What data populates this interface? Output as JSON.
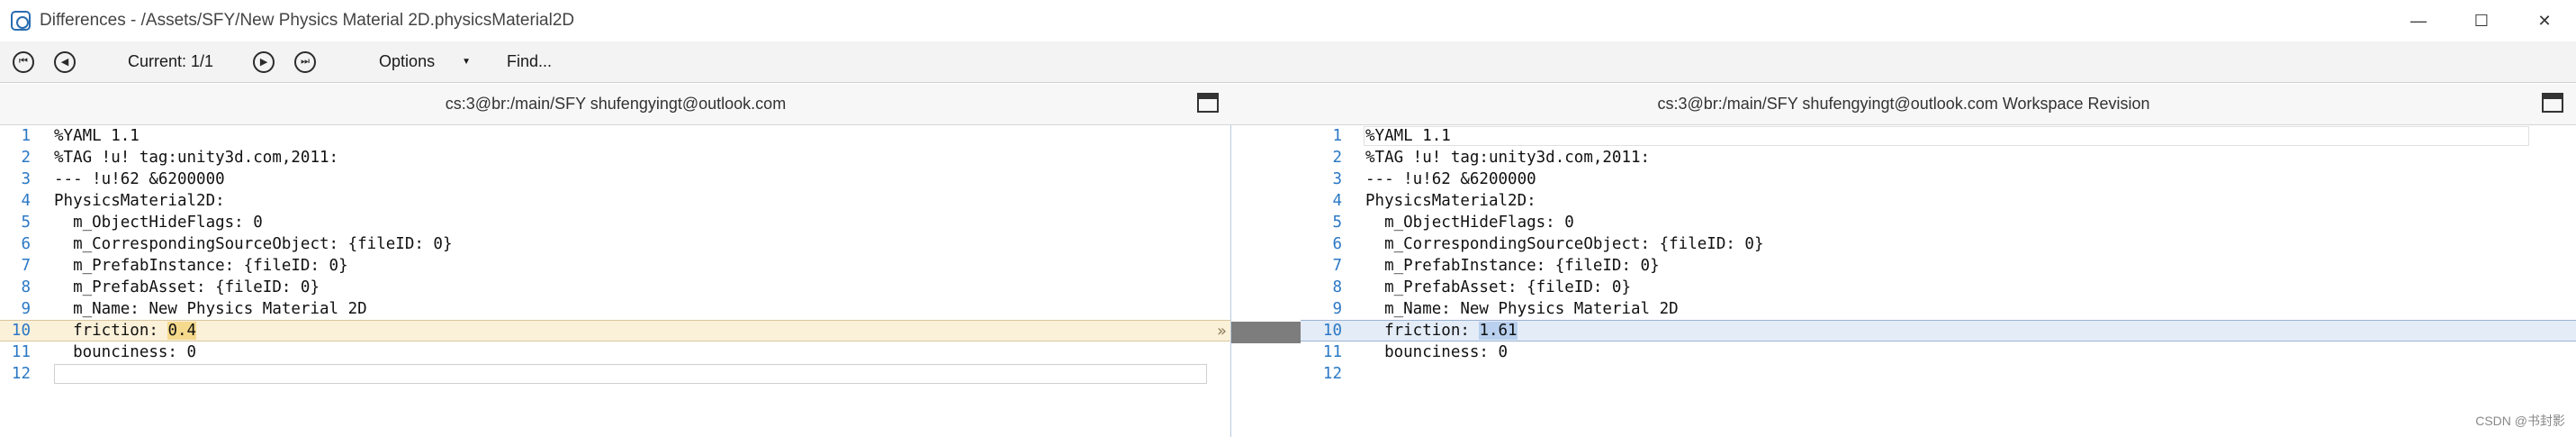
{
  "window": {
    "title": "Differences - /Assets/SFY/New Physics Material 2D.physicsMaterial2D",
    "minimize_glyph": "—",
    "maximize_glyph": "☐",
    "close_glyph": "✕"
  },
  "toolbar": {
    "first_glyph": "⏮",
    "prev_glyph": "◀",
    "current_label": "Current: 1/1",
    "next_glyph": "▶",
    "last_glyph": "⏭",
    "options_label": "Options",
    "options_caret": "▼",
    "find_label": "Find..."
  },
  "left_pane": {
    "header": "cs:3@br:/main/SFY shufengyingt@outlook.com",
    "lines": [
      {
        "num": "1",
        "text": "%YAML 1.1"
      },
      {
        "num": "2",
        "text": "%TAG !u! tag:unity3d.com,2011:"
      },
      {
        "num": "3",
        "text": "--- !u!62 &6200000"
      },
      {
        "num": "4",
        "text": "PhysicsMaterial2D:"
      },
      {
        "num": "5",
        "text": "  m_ObjectHideFlags: 0"
      },
      {
        "num": "6",
        "text": "  m_CorrespondingSourceObject: {fileID: 0}"
      },
      {
        "num": "7",
        "text": "  m_PrefabInstance: {fileID: 0}"
      },
      {
        "num": "8",
        "text": "  m_PrefabAsset: {fileID: 0}"
      },
      {
        "num": "9",
        "text": "  m_Name: New Physics Material 2D"
      },
      {
        "num": "10",
        "text_prefix": "  friction: ",
        "text_changed": "0.4"
      },
      {
        "num": "11",
        "text": "  bounciness: 0"
      },
      {
        "num": "12",
        "text": ""
      }
    ],
    "merge_arrow": "»"
  },
  "right_pane": {
    "header": "cs:3@br:/main/SFY shufengyingt@outlook.com Workspace Revision",
    "lines": [
      {
        "num": "1",
        "text": "%YAML 1.1"
      },
      {
        "num": "2",
        "text": "%TAG !u! tag:unity3d.com,2011:"
      },
      {
        "num": "3",
        "text": "--- !u!62 &6200000"
      },
      {
        "num": "4",
        "text": "PhysicsMaterial2D:"
      },
      {
        "num": "5",
        "text": "  m_ObjectHideFlags: 0"
      },
      {
        "num": "6",
        "text": "  m_CorrespondingSourceObject: {fileID: 0}"
      },
      {
        "num": "7",
        "text": "  m_PrefabInstance: {fileID: 0}"
      },
      {
        "num": "8",
        "text": "  m_PrefabAsset: {fileID: 0}"
      },
      {
        "num": "9",
        "text": "  m_Name: New Physics Material 2D"
      },
      {
        "num": "10",
        "text_prefix": "  friction: ",
        "text_changed": "1.61"
      },
      {
        "num": "11",
        "text": "  bounciness: 0"
      },
      {
        "num": "12",
        "text": ""
      }
    ]
  },
  "watermark": "CSDN @书封影",
  "colors": {
    "line_number": "#2b78c5",
    "left_change_bg": "#fbf0d8",
    "right_change_bg": "#e4ecf7",
    "gutter_bar": "#7d7d7d"
  }
}
